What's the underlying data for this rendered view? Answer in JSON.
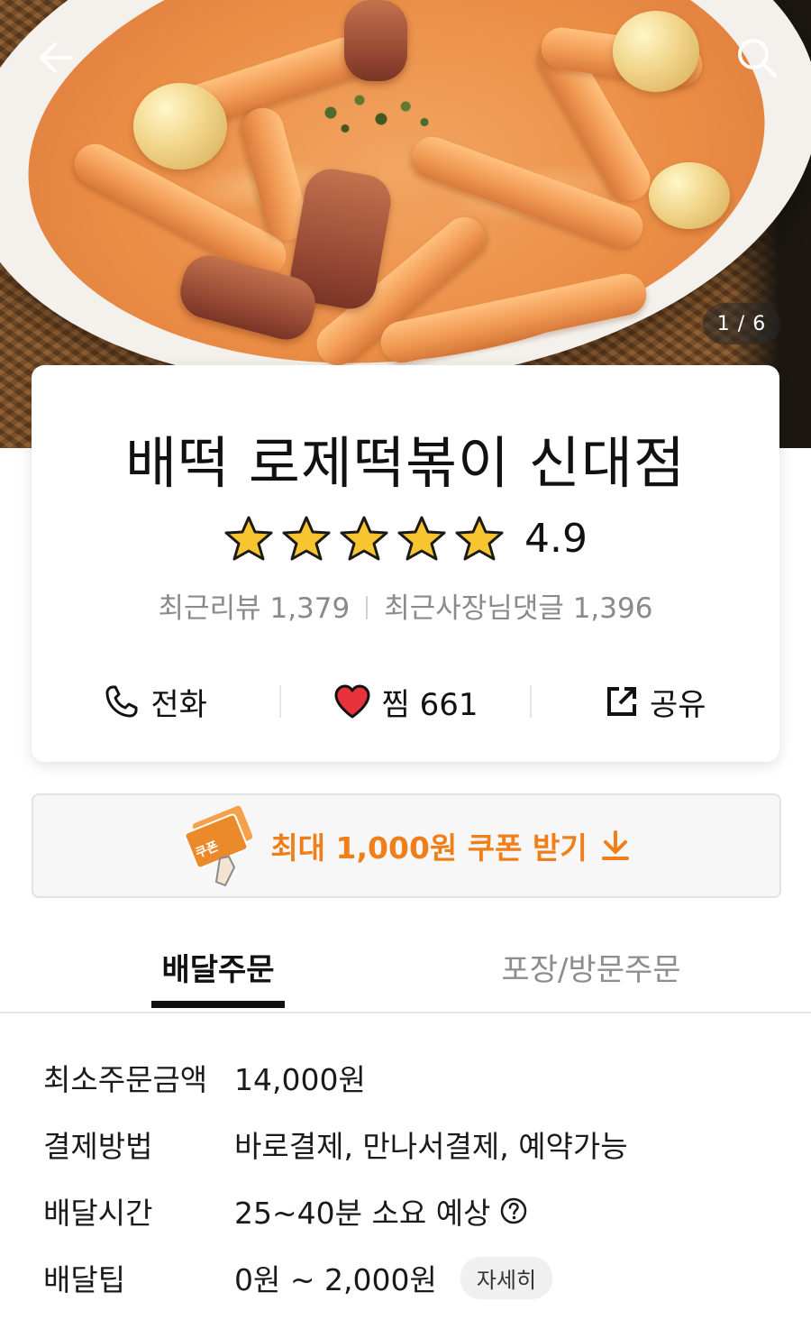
{
  "hero": {
    "image_counter": "1 / 6",
    "back_icon": "arrow-left-icon",
    "search_icon": "search-icon"
  },
  "store": {
    "name": "배떡 로제떡볶이 신대점",
    "rating": "4.9",
    "stars": 5,
    "recent_reviews": "최근리뷰 1,379",
    "recent_owner_replies": "최근사장님댓글 1,396",
    "actions": {
      "call": "전화",
      "favorite": "찜 661",
      "share": "공유"
    }
  },
  "coupon": {
    "badge": "쿠폰",
    "label": "최대 1,000원 쿠폰 받기"
  },
  "tabs": {
    "delivery": "배달주문",
    "pickup": "포장/방문주문"
  },
  "info": {
    "min_order_label": "최소주문금액",
    "min_order_value": "14,000원",
    "payment_label": "결제방법",
    "payment_value": "바로결제, 만나서결제, 예약가능",
    "delivery_time_label": "배달시간",
    "delivery_time_value": "25~40분 소요 예상",
    "delivery_tip_label": "배달팁",
    "delivery_tip_value": "0원 ~ 2,000원",
    "detail_button": "자세히"
  },
  "colors": {
    "accent_orange": "#f07f1a",
    "star_yellow": "#f6c52f",
    "heart_red": "#e8323c"
  }
}
